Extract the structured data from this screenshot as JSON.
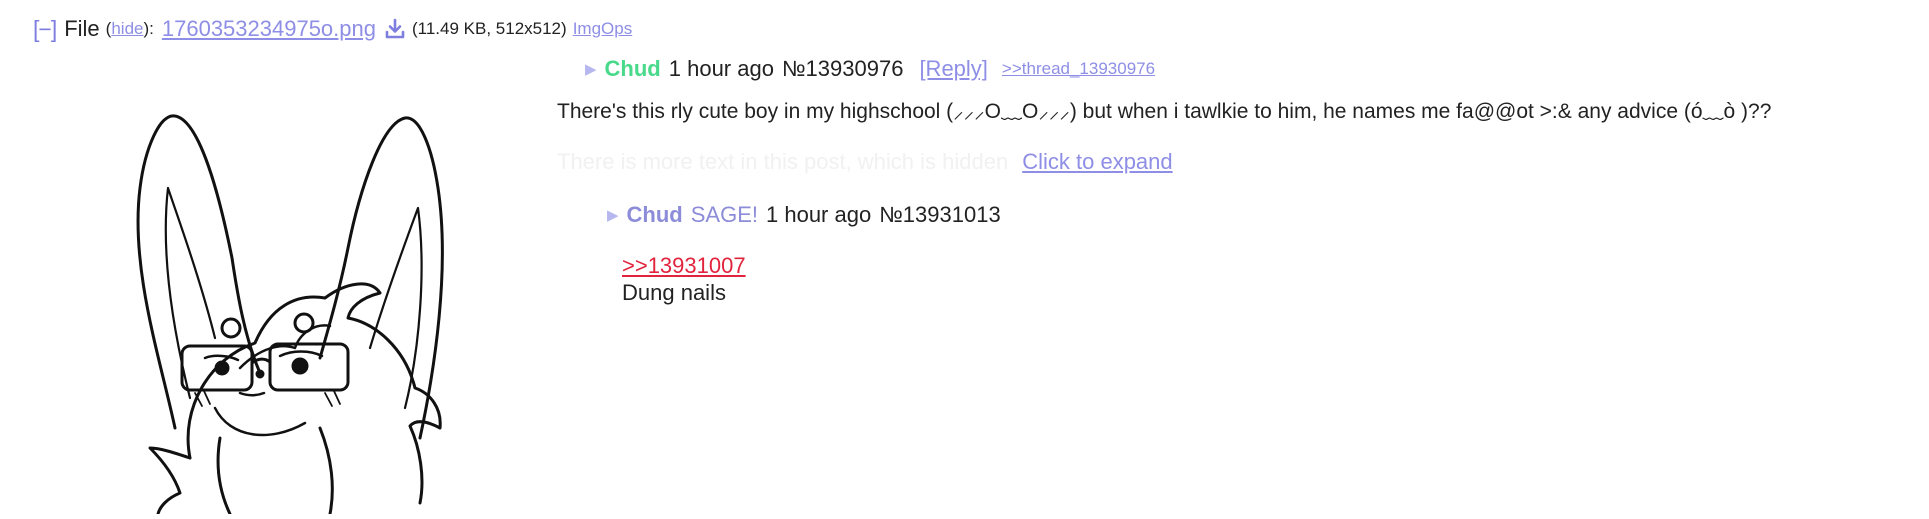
{
  "colors": {
    "link": "#8e8ee6",
    "op_name": "#48d98a",
    "reply_name": "#8c8cd8",
    "quote_link": "#e2233d",
    "text": "#222222",
    "background": "#ffffff"
  },
  "file": {
    "collapse_label": "[−]",
    "label": "File",
    "hide_open": "(",
    "hide_label": "hide",
    "hide_close": "):",
    "filename": "1760353234975o.png",
    "download_icon": "download-icon",
    "meta": "(11.49 KB, 512x512)",
    "imgops_label": "ImgOps"
  },
  "op_post": {
    "arrow": "▶",
    "name": "Chud",
    "time": "1 hour ago",
    "number": "№13930976",
    "reply_label": "[Reply]",
    "thread_link": ">>thread_13930976",
    "text": "There's this rly cute boy in my highschool (⸝⸝⸝O﹏O⸝⸝⸝) but when i tawlkie to him, he names me fa@@ot >:& any advice (ó﹏ò )??",
    "faded_text": "There is more text in this post, which is hidden",
    "expand_label": "Click to expand"
  },
  "reply_post": {
    "arrow": "▶",
    "name": "Chud",
    "sage": "SAGE!",
    "time": "1 hour ago",
    "number": "№13931013",
    "quote": ">>13931007",
    "text": "Dung nails"
  }
}
